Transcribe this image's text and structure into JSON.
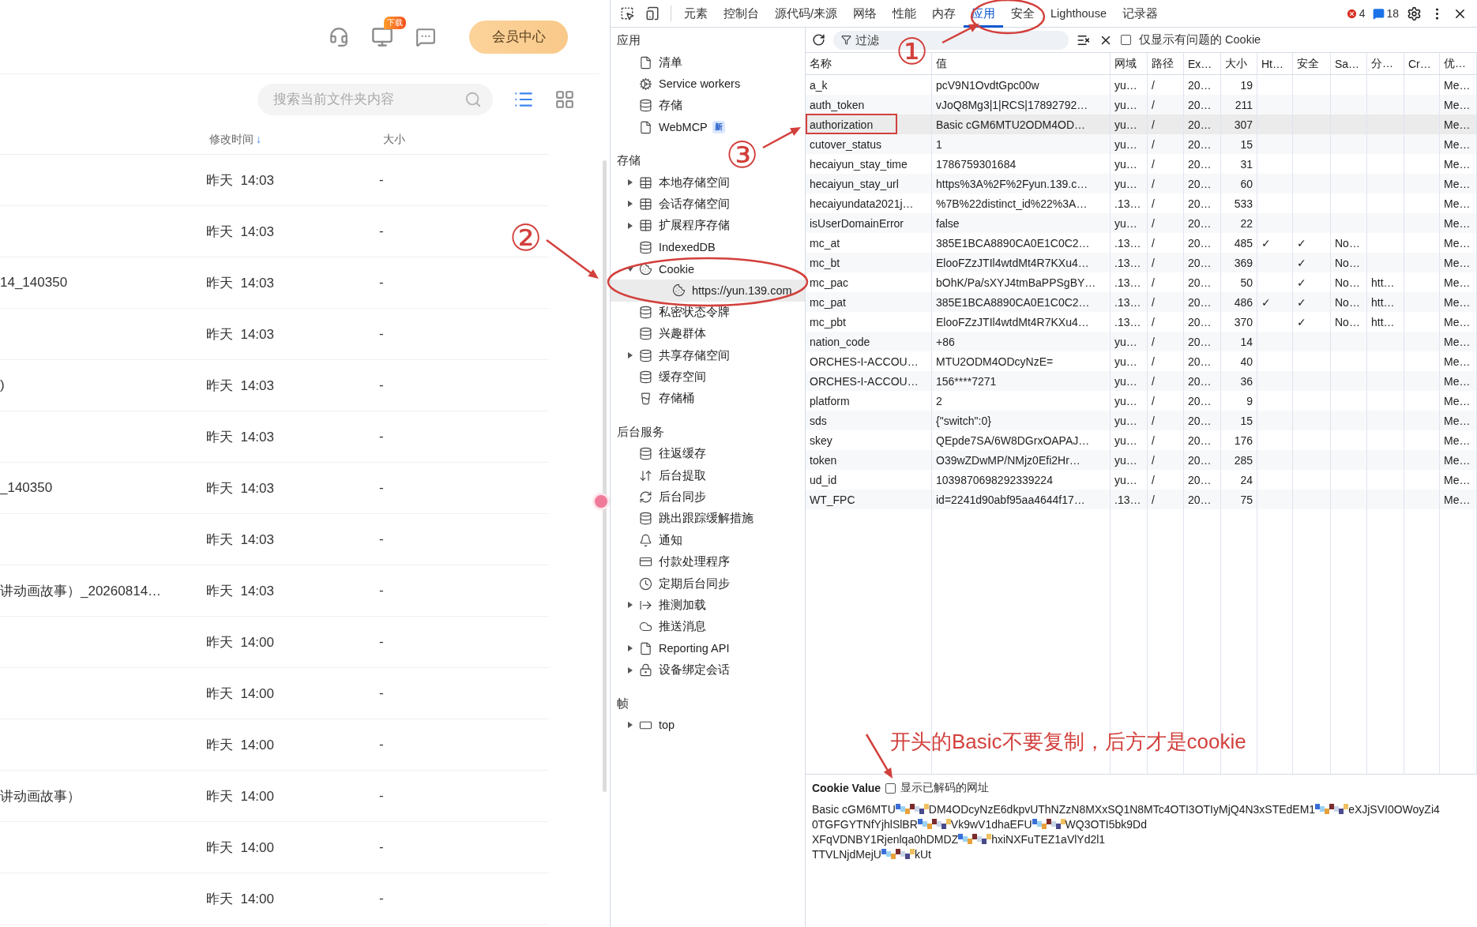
{
  "file_app": {
    "member_button": "会员中心",
    "pc_badge": "下载",
    "search": {
      "placeholder": "搜索当前文件夹内容"
    },
    "view_modes": [
      {
        "kind": "list",
        "selected": true
      },
      {
        "kind": "grid",
        "selected": false
      }
    ],
    "columns": [
      {
        "label": "修改时间",
        "sort_indicator": "↓"
      },
      {
        "label": "大小"
      }
    ],
    "rows": [
      {
        "modified": "昨天  14:03",
        "size": "-"
      },
      {
        "modified": "昨天  14:03",
        "size": "-"
      },
      {
        "name": "14_140350",
        "modified": "昨天  14:03",
        "size": "-"
      },
      {
        "modified": "昨天  14:03",
        "size": "-"
      },
      {
        "name": ")",
        "modified": "昨天  14:03",
        "size": "-"
      },
      {
        "modified": "昨天  14:03",
        "size": "-"
      },
      {
        "name": "_140350",
        "modified": "昨天  14:03",
        "size": "-"
      },
      {
        "modified": "昨天  14:03",
        "size": "-"
      },
      {
        "name": "讲动画故事）_20260814…",
        "modified": "昨天  14:03",
        "size": "-"
      },
      {
        "modified": "昨天  14:00",
        "size": "-"
      },
      {
        "modified": "昨天  14:00",
        "size": "-"
      },
      {
        "modified": "昨天  14:00",
        "size": "-"
      },
      {
        "name": "讲动画故事）",
        "modified": "昨天  14:00",
        "size": "-"
      },
      {
        "modified": "昨天  14:00",
        "size": "-"
      },
      {
        "modified": "昨天  14:00",
        "size": "-"
      }
    ]
  },
  "devtools": {
    "tabs": [
      {
        "label": "元素",
        "selected": false
      },
      {
        "label": "控制台",
        "selected": false
      },
      {
        "label": "源代码/来源",
        "selected": false
      },
      {
        "label": "网络",
        "selected": false
      },
      {
        "label": "性能",
        "selected": false
      },
      {
        "label": "内存",
        "selected": false
      },
      {
        "label": "应用",
        "selected": true
      },
      {
        "label": "安全",
        "selected": false
      },
      {
        "label": "Lighthouse",
        "selected": false
      },
      {
        "label": "记录器",
        "selected": false
      }
    ],
    "error_count": "4",
    "message_count": "18",
    "sidebar": [
      {
        "title": "应用",
        "items": [
          {
            "label": "清单",
            "kind": "file",
            "selected": false
          },
          {
            "label": "Service workers",
            "kind": "gears",
            "selected": false
          },
          {
            "label": "存储",
            "kind": "database",
            "selected": false
          },
          {
            "label": "WebMCP",
            "kind": "file",
            "badge": "新",
            "selected": false
          }
        ]
      },
      {
        "title": "存储",
        "items": [
          {
            "label": "本地存储空间",
            "kind": "table",
            "expanded": false,
            "selected": false
          },
          {
            "label": "会话存储空间",
            "kind": "table",
            "expanded": false,
            "selected": false
          },
          {
            "label": "扩展程序存储",
            "kind": "table",
            "expanded": false,
            "selected": false
          },
          {
            "label": "IndexedDB",
            "kind": "database",
            "selected": false
          },
          {
            "label": "Cookie",
            "kind": "cookie",
            "expanded": true,
            "selected": false,
            "children": [
              {
                "label": "https://yun.139.com",
                "kind": "cookie",
                "selected": true
              }
            ]
          },
          {
            "label": "私密状态令牌",
            "kind": "database",
            "selected": false
          },
          {
            "label": "兴趣群体",
            "kind": "database",
            "selected": false
          },
          {
            "label": "共享存储空间",
            "kind": "database",
            "expanded": false,
            "selected": false
          },
          {
            "label": "缓存空间",
            "kind": "database",
            "selected": false
          },
          {
            "label": "存储桶",
            "kind": "bucket",
            "selected": false
          }
        ]
      },
      {
        "title": "后台服务",
        "items": [
          {
            "label": "往返缓存",
            "kind": "database",
            "selected": false
          },
          {
            "label": "后台提取",
            "kind": "updown",
            "selected": false
          },
          {
            "label": "后台同步",
            "kind": "sync",
            "selected": false
          },
          {
            "label": "跳出跟踪缓解措施",
            "kind": "database",
            "selected": false
          },
          {
            "label": "通知",
            "kind": "bell",
            "selected": false
          },
          {
            "label": "付款处理程序",
            "kind": "card",
            "selected": false
          },
          {
            "label": "定期后台同步",
            "kind": "clock",
            "selected": false
          },
          {
            "label": "推测加载",
            "kind": "arrow",
            "expanded": false,
            "selected": false
          },
          {
            "label": "推送消息",
            "kind": "cloud",
            "selected": false
          },
          {
            "label": "Reporting API",
            "kind": "file",
            "expanded": false,
            "selected": false
          },
          {
            "label": "设备绑定会话",
            "kind": "lock",
            "expanded": false,
            "selected": false
          }
        ]
      },
      {
        "title": "帧",
        "items": [
          {
            "label": "top",
            "kind": "window",
            "expanded": false,
            "selected": false
          }
        ]
      }
    ],
    "cookie_toolbar": {
      "filter_placeholder": "过滤",
      "only_issues": {
        "label": "仅显示有问题的 Cookie",
        "checked": false
      }
    },
    "table": {
      "columns": [
        "名称",
        "值",
        "网域",
        "路径",
        "Ex…",
        "大小",
        "Ht…",
        "安全",
        "Sa…",
        "分…",
        "Cr…",
        "优…"
      ],
      "rows": [
        {
          "name": "a_k",
          "value": "pcV9N1OvdtGpc00w",
          "domain": "yu…",
          "path": "/",
          "expires": "20…",
          "size": "19",
          "priority": "Me…",
          "selected": false
        },
        {
          "name": "auth_token",
          "value": "vJoQ8Mg3|1|RCS|17892792…",
          "domain": "yu…",
          "path": "/",
          "expires": "20…",
          "size": "211",
          "priority": "Me…",
          "selected": false
        },
        {
          "name": "authorization",
          "value": "Basic cGM6MTU2ODM4OD…",
          "domain": "yu…",
          "path": "/",
          "expires": "20…",
          "size": "307",
          "priority": "Me…",
          "selected": true
        },
        {
          "name": "cutover_status",
          "value": "1",
          "domain": "yu…",
          "path": "/",
          "expires": "20…",
          "size": "15",
          "priority": "Me…",
          "selected": false
        },
        {
          "name": "hecaiyun_stay_time",
          "value": "1786759301684",
          "domain": "yu…",
          "path": "/",
          "expires": "20…",
          "size": "31",
          "priority": "Me…",
          "selected": false
        },
        {
          "name": "hecaiyun_stay_url",
          "value": "https%3A%2F%2Fyun.139.c…",
          "domain": "yu…",
          "path": "/",
          "expires": "20…",
          "size": "60",
          "priority": "Me…",
          "selected": false
        },
        {
          "name": "hecaiyundata2021j…",
          "value": "%7B%22distinct_id%22%3A…",
          "domain": ".13…",
          "path": "/",
          "expires": "20…",
          "size": "533",
          "priority": "Me…",
          "selected": false
        },
        {
          "name": "isUserDomainError",
          "value": "false",
          "domain": "yu…",
          "path": "/",
          "expires": "20…",
          "size": "22",
          "priority": "Me…",
          "selected": false
        },
        {
          "name": "mc_at",
          "value": "385E1BCA8890CA0E1C0C2…",
          "domain": ".13…",
          "path": "/",
          "expires": "20…",
          "size": "485",
          "http_only": "✓",
          "secure": "✓",
          "same_site": "No…",
          "priority": "Me…",
          "selected": false
        },
        {
          "name": "mc_bt",
          "value": "ElooFZzJTIl4wtdMt4R7KXu4…",
          "domain": ".13…",
          "path": "/",
          "expires": "20…",
          "size": "369",
          "secure": "✓",
          "same_site": "No…",
          "priority": "Me…",
          "selected": false
        },
        {
          "name": "mc_pac",
          "value": "bOhK/Pa/sXYJ4tmBaPPSgBY…",
          "domain": ".13…",
          "path": "/",
          "expires": "20…",
          "size": "50",
          "secure": "✓",
          "same_site": "No…",
          "partition_key": "htt…",
          "priority": "Me…",
          "selected": false
        },
        {
          "name": "mc_pat",
          "value": "385E1BCA8890CA0E1C0C2…",
          "domain": ".13…",
          "path": "/",
          "expires": "20…",
          "size": "486",
          "http_only": "✓",
          "secure": "✓",
          "same_site": "No…",
          "partition_key": "htt…",
          "priority": "Me…",
          "selected": false
        },
        {
          "name": "mc_pbt",
          "value": "ElooFZzJTIl4wtdMt4R7KXu4…",
          "domain": ".13…",
          "path": "/",
          "expires": "20…",
          "size": "370",
          "secure": "✓",
          "same_site": "No…",
          "partition_key": "htt…",
          "priority": "Me…",
          "selected": false
        },
        {
          "name": "nation_code",
          "value": "+86",
          "domain": "yu…",
          "path": "/",
          "expires": "20…",
          "size": "14",
          "priority": "Me…",
          "selected": false
        },
        {
          "name": "ORCHES-I-ACCOU…",
          "value": "MTU2ODM4ODcyNzE=",
          "domain": "yu…",
          "path": "/",
          "expires": "20…",
          "size": "40",
          "priority": "Me…",
          "selected": false
        },
        {
          "name": "ORCHES-I-ACCOU…",
          "value": "156****7271",
          "domain": "yu…",
          "path": "/",
          "expires": "20…",
          "size": "36",
          "priority": "Me…",
          "selected": false
        },
        {
          "name": "platform",
          "value": "2",
          "domain": "yu…",
          "path": "/",
          "expires": "20…",
          "size": "9",
          "priority": "Me…",
          "selected": false
        },
        {
          "name": "sds",
          "value": "{\"switch\":0}",
          "domain": "yu…",
          "path": "/",
          "expires": "20…",
          "size": "15",
          "priority": "Me…",
          "selected": false
        },
        {
          "name": "skey",
          "value": "QEpde7SA/6W8DGrxOAPAJ…",
          "domain": "yu…",
          "path": "/",
          "expires": "20…",
          "size": "176",
          "priority": "Me…",
          "selected": false
        },
        {
          "name": "token",
          "value": "O39wZDwMP/NMjz0Efi2Hr…",
          "domain": "yu…",
          "path": "/",
          "expires": "20…",
          "size": "285",
          "priority": "Me…",
          "selected": false
        },
        {
          "name": "ud_id",
          "value": "1039870698292339224",
          "domain": "yu…",
          "path": "/",
          "expires": "20…",
          "size": "24",
          "priority": "Me…",
          "selected": false
        },
        {
          "name": "WT_FPC",
          "value": "id=2241d90abf95aa4644f17…",
          "domain": ".13…",
          "path": "/",
          "expires": "20…",
          "size": "75",
          "priority": "Me…",
          "selected": false
        }
      ]
    },
    "cookie_value": {
      "title": "Cookie Value",
      "decode": {
        "label": "显示已解码的网址",
        "checked": false
      },
      "lines": [
        [
          {
            "kind": "text",
            "text": "Basic cGM6MTU"
          },
          {
            "kind": "mosaic"
          },
          {
            "kind": "text",
            "text": "DM4ODcyNzE6dkpvUThNZzN8MXxSQ1N8MTc4OTI3OTIyMjQ4N3xSTEdEM1"
          },
          {
            "kind": "mosaic"
          },
          {
            "kind": "text",
            "text": "eXJjSVI0OWoyZi4"
          }
        ],
        [
          {
            "kind": "text",
            "text": "0TGFGYTNfYjhlSlBR"
          },
          {
            "kind": "mosaic"
          },
          {
            "kind": "text",
            "text": "Vk9wV1dhaEFU"
          },
          {
            "kind": "mosaic"
          },
          {
            "kind": "text",
            "text": "WQ3OTI5bk9Dd"
          }
        ],
        [
          {
            "kind": "text",
            "text": "XFqVDNBY1Rjenlqa0hDMDZ"
          },
          {
            "kind": "mosaic"
          },
          {
            "kind": "text",
            "text": "hxiNXFuTEZ1aVlYd2l1"
          }
        ],
        [
          {
            "kind": "text",
            "text": "TTVLNjdMejU"
          },
          {
            "kind": "mosaic"
          },
          {
            "kind": "text",
            "text": "kUt"
          }
        ]
      ]
    }
  },
  "annotations": {
    "steps": [
      "①",
      "②",
      "③"
    ],
    "note": "开头的Basic不要复制，后方才是cookie"
  }
}
